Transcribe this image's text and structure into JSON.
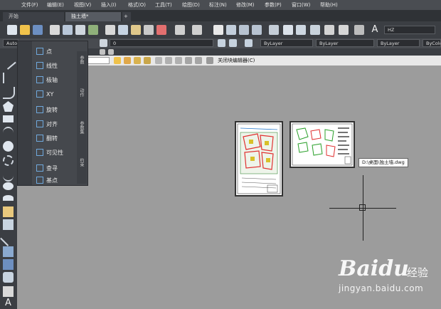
{
  "menubar": {
    "items": [
      "文件(F)",
      "编辑(E)",
      "视图(V)",
      "插入(I)",
      "格式(O)",
      "工具(T)",
      "绘图(D)",
      "标注(N)",
      "修改(M)",
      "参数(P)",
      "窗口(W)",
      "帮助(H)"
    ]
  },
  "tabs": [
    {
      "label": "开始"
    },
    {
      "label": "独土墙*"
    }
  ],
  "tab_add": "+",
  "toolbar": {
    "font_dropdown": "HZ",
    "layer_dropdown": "0",
    "color_dropdown": "ByLayer",
    "linetype_dropdown": "ByLayer",
    "lineweight_dropdown": "ByLayer",
    "plotstyle_dropdown": "ByColor",
    "auto_label": "Auto",
    "close_block_editor": "关闭块编辑器(C)"
  },
  "flyout": {
    "items": [
      {
        "label": "点"
      },
      {
        "label": "线性"
      },
      {
        "label": "极轴"
      },
      {
        "label": "XY"
      },
      {
        "label": "旋转"
      },
      {
        "label": "对齐"
      },
      {
        "label": "翻转"
      },
      {
        "label": "可见性"
      },
      {
        "label": "查寻"
      },
      {
        "label": "基点"
      }
    ],
    "side_tabs": [
      "参数",
      "动作",
      "参数集",
      "约束"
    ]
  },
  "drawing": {
    "tooltip": "D:\\桌面\\独土墙.dwg"
  },
  "watermark": {
    "brand": "Baidu",
    "cn": "经验",
    "url": "jingyan.baidu.com"
  }
}
